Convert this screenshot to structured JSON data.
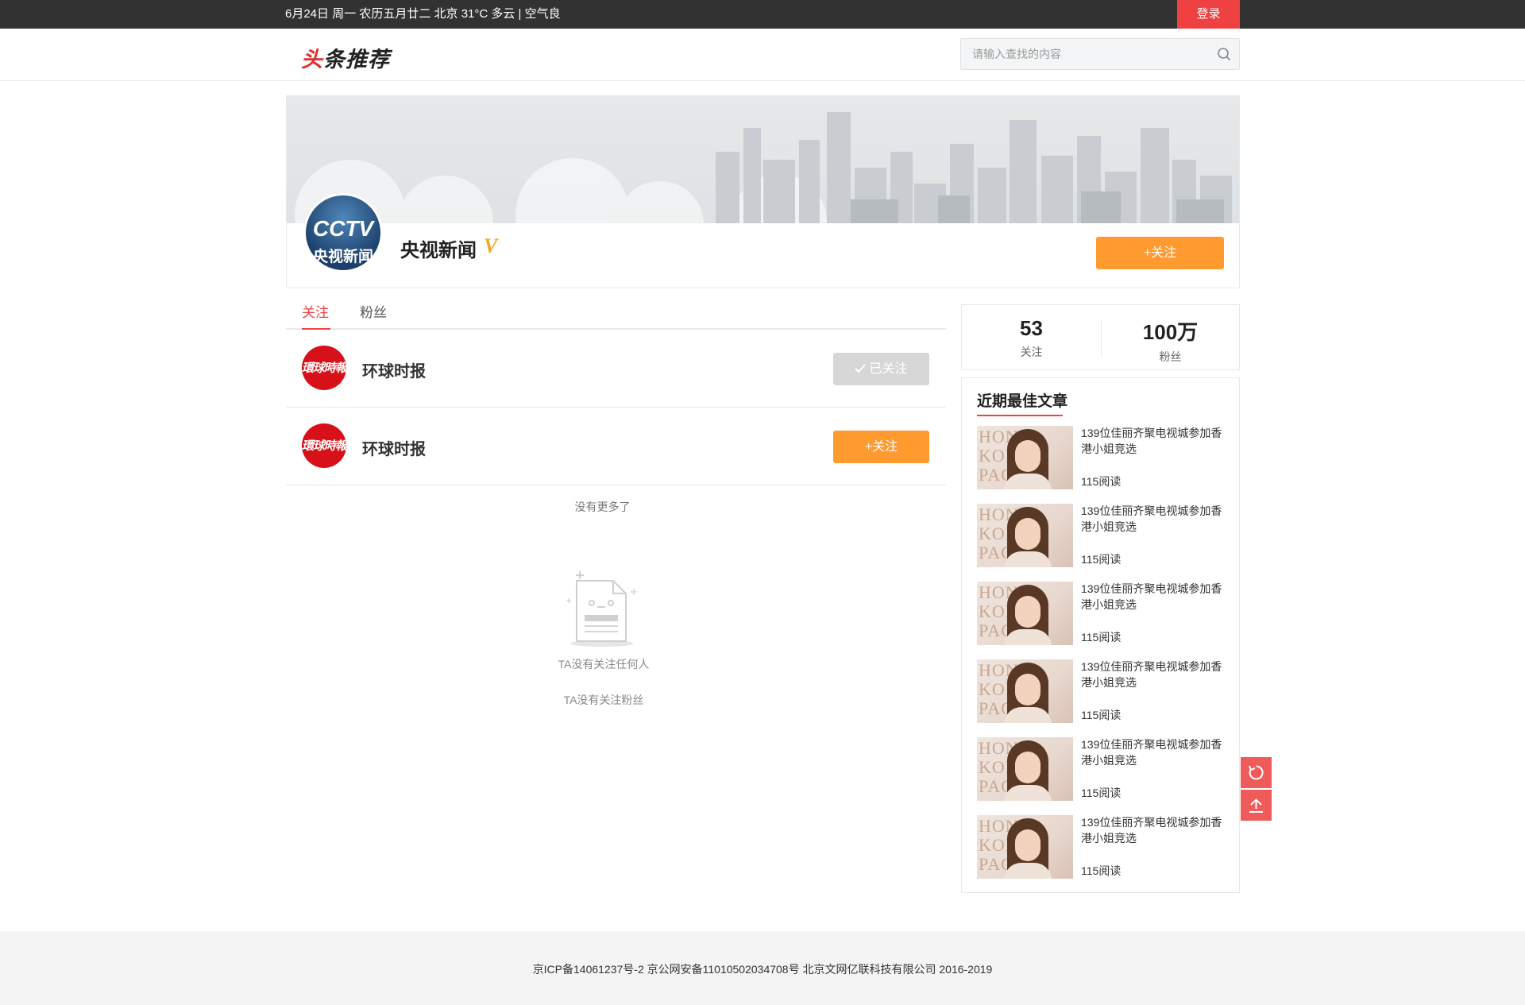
{
  "topbar": {
    "info": "6月24日 周一 农历五月廿二  北京 31°C 多云 | 空气良",
    "login_label": "登录"
  },
  "header": {
    "logo_red": "头",
    "logo_rest": "条推荐",
    "search_placeholder": "请输入查找的内容"
  },
  "profile": {
    "avatar_line1": "CCTV",
    "avatar_line2": "央视新闻",
    "name": "央视新闻",
    "verified_badge": "V",
    "follow_label": "+关注"
  },
  "tabs": [
    {
      "label": "关注",
      "active": true
    },
    {
      "label": "粉丝",
      "active": false
    }
  ],
  "following": [
    {
      "avatar_text": "環球時報",
      "name": "环球时报",
      "button": "已关注",
      "followed": true
    },
    {
      "avatar_text": "環球時報",
      "name": "环球时报",
      "button": "+关注",
      "followed": false
    }
  ],
  "no_more": "没有更多了",
  "empty": {
    "line1": "TA没有关注任何人",
    "line2": "TA没有关注粉丝"
  },
  "stats": {
    "following_count": "53",
    "following_label": "关注",
    "fans_count": "100万",
    "fans_label": "粉丝"
  },
  "best_articles": {
    "title": "近期最佳文章",
    "thumb_text": "HONG KONG PAGE",
    "items": [
      {
        "title": "139位佳丽齐聚电视城参加香港小姐竞选",
        "reads": "115阅读"
      },
      {
        "title": "139位佳丽齐聚电视城参加香港小姐竞选",
        "reads": "115阅读"
      },
      {
        "title": "139位佳丽齐聚电视城参加香港小姐竞选",
        "reads": "115阅读"
      },
      {
        "title": "139位佳丽齐聚电视城参加香港小姐竞选",
        "reads": "115阅读"
      },
      {
        "title": "139位佳丽齐聚电视城参加香港小姐竞选",
        "reads": "115阅读"
      },
      {
        "title": "139位佳丽齐聚电视城参加香港小姐竞选",
        "reads": "115阅读"
      }
    ]
  },
  "float_tools": [
    {
      "icon": "refresh-icon"
    },
    {
      "icon": "back-to-top-icon"
    }
  ],
  "footer": {
    "copyright": "京ICP备14061237号-2  京公网安备11010502034708号  北京文网亿联科技有限公司 2016-2019"
  },
  "colors": {
    "brand_red": "#f04142",
    "follow_orange": "#ff9a2e",
    "topbar_bg": "#323232",
    "verified_gold": "#f5a623"
  }
}
